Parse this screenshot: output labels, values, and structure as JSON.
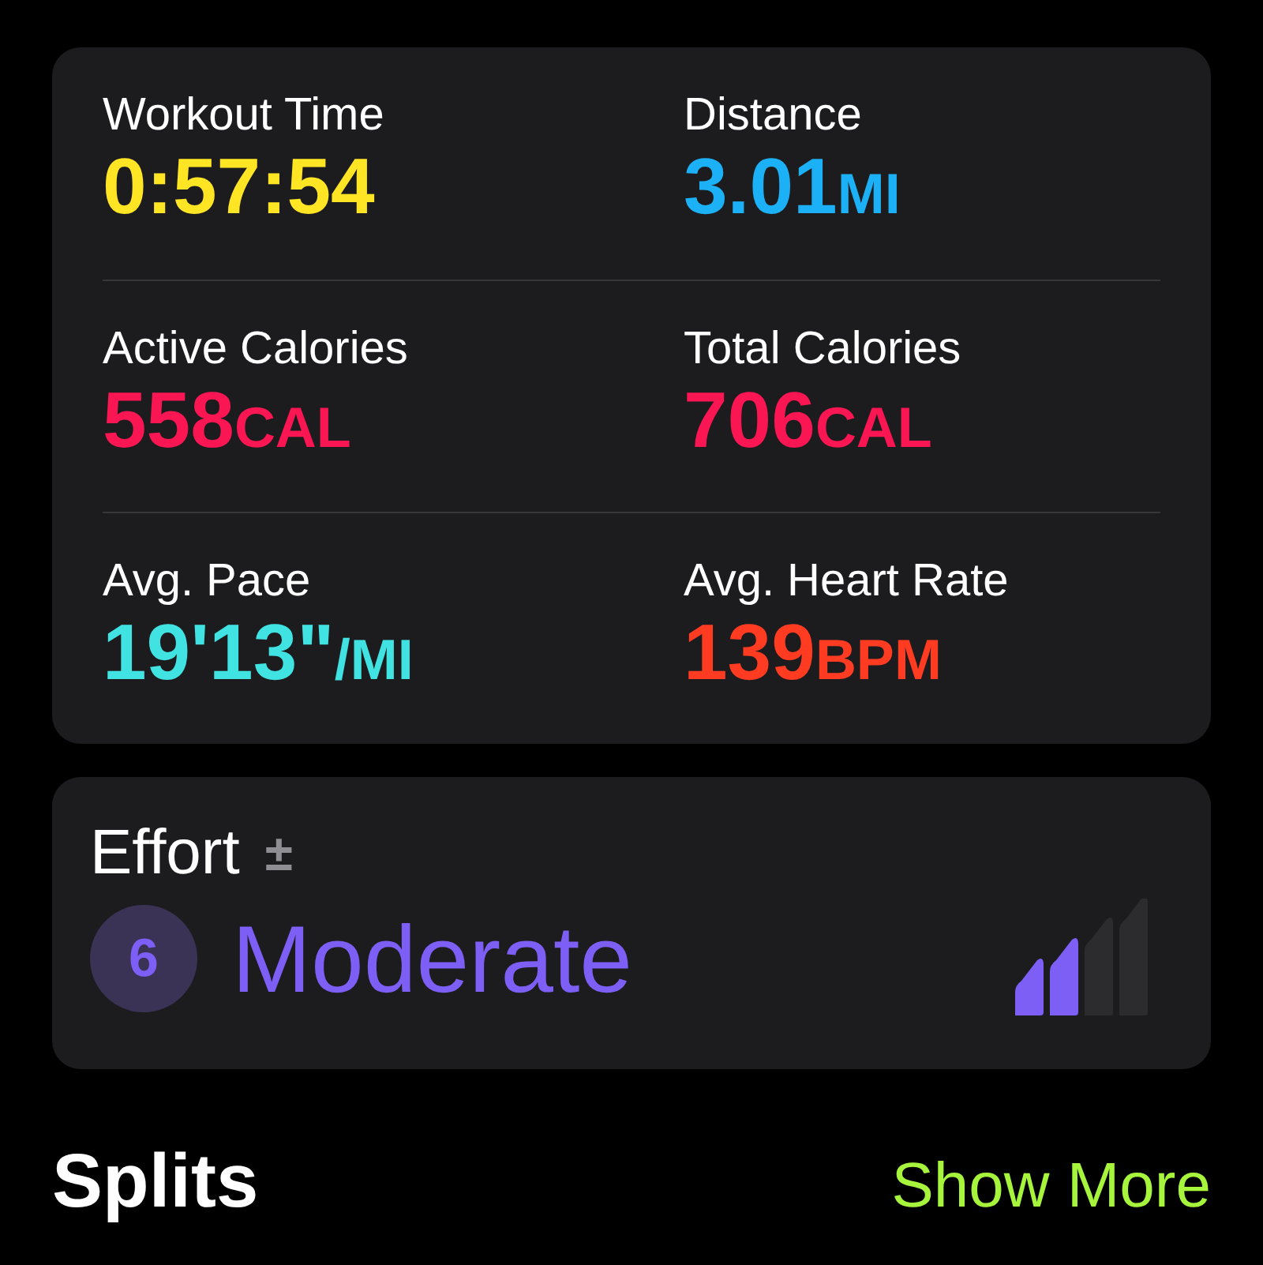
{
  "stats": [
    {
      "label": "Workout Time",
      "value": "0:57:54",
      "color": "#ffe524"
    },
    {
      "label": "Distance",
      "value": "3.01",
      "unit": "MI",
      "color": "#1cb1f6"
    },
    {
      "label": "Active Calories",
      "value": "558",
      "unit": "CAL",
      "color": "#fa1553"
    },
    {
      "label": "Total Calories",
      "value": "706",
      "unit": "CAL",
      "color": "#fa1553"
    },
    {
      "label": "Avg. Pace",
      "value": "19'13\"",
      "unit": "/MI",
      "color": "#40e2e2"
    },
    {
      "label": "Avg. Heart Rate",
      "value": "139",
      "unit": "BPM",
      "color": "#ff3b22"
    }
  ],
  "effort": {
    "title": "Effort",
    "adjust": "±",
    "score": "6",
    "rating": "Moderate",
    "level": 0.5
  },
  "splits": {
    "title": "Splits",
    "action": "Show More"
  }
}
